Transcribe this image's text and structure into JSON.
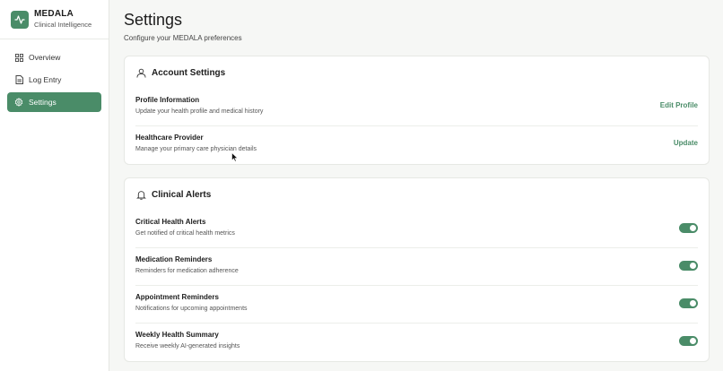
{
  "brand": {
    "name": "MEDALA",
    "subtitle": "Clinical Intelligence",
    "logo_icon": "activity-pulse-icon",
    "color": "#4a8c68"
  },
  "nav": [
    {
      "label": "Overview",
      "icon": "grid-icon",
      "active": false
    },
    {
      "label": "Log Entry",
      "icon": "document-icon",
      "active": false
    },
    {
      "label": "Settings",
      "icon": "gear-icon",
      "active": true
    }
  ],
  "page": {
    "title": "Settings",
    "subtitle": "Configure your MEDALA preferences"
  },
  "account": {
    "title": "Account Settings",
    "icon": "user-icon",
    "rows": [
      {
        "title": "Profile Information",
        "desc": "Update your health profile and medical history",
        "action": "Edit Profile"
      },
      {
        "title": "Healthcare Provider",
        "desc": "Manage your primary care physician details",
        "action": "Update"
      }
    ]
  },
  "alerts": {
    "title": "Clinical Alerts",
    "icon": "bell-icon",
    "rows": [
      {
        "title": "Critical Health Alerts",
        "desc": "Get notified of critical health metrics",
        "enabled": true
      },
      {
        "title": "Medication Reminders",
        "desc": "Reminders for medication adherence",
        "enabled": true
      },
      {
        "title": "Appointment Reminders",
        "desc": "Notifications for upcoming appointments",
        "enabled": true
      },
      {
        "title": "Weekly Health Summary",
        "desc": "Receive weekly AI-generated insights",
        "enabled": true
      }
    ]
  }
}
